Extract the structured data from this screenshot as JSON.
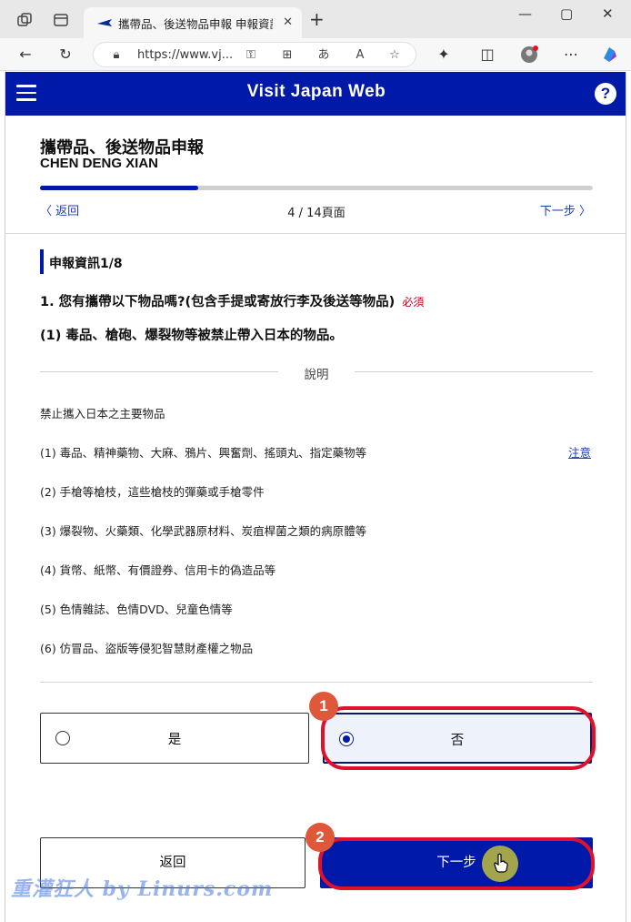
{
  "browser": {
    "tab_title": "攜帶品、後送物品申報 申報資訊",
    "tab_close": "✕",
    "new_tab": "+",
    "url": "https://www.vj...",
    "window_controls": [
      "—",
      "▢",
      "✕"
    ]
  },
  "header": {
    "site_title": "Visit Japan Web",
    "help_label": "?"
  },
  "form": {
    "title": "攜帶品、後送物品申報",
    "name": "CHEN DENG XIAN",
    "progress": {
      "current": 4,
      "total": 14
    },
    "back_link": "返回",
    "page_indicator": "4 / 14頁面",
    "next_link": "下一步"
  },
  "section": {
    "label": "申報資訊1/8",
    "question": "1. 您有攜帶以下物品嗎?(包含手提或寄放行李及後送等物品)",
    "required": "必須",
    "sub_question": "(1) 毒品、槍砲、爆裂物等被禁止帶入日本的物品。"
  },
  "explanation": {
    "heading": "說明",
    "intro": "禁止攜入日本之主要物品",
    "items": [
      "(1) 毒品、精神藥物、大麻、鴉片、興奮劑、搖頭丸、指定藥物等",
      "(2) 手槍等槍枝，這些槍枝的彈藥或手槍零件",
      "(3) 爆裂物、火藥類、化學武器原材料、炭疽桿菌之類的病原體等",
      "(4) 貨幣、紙幣、有價證券、信用卡的偽造品等",
      "(5) 色情雜誌、色情DVD、兒童色情等",
      "(6) 仿冒品、盜版等侵犯智慧財產權之物品"
    ],
    "note_link": "注意"
  },
  "options": {
    "yes": "是",
    "no": "否",
    "selected": "no"
  },
  "buttons": {
    "back": "返回",
    "next": "下一步"
  },
  "annotations": {
    "badge_1": "1",
    "badge_2": "2",
    "watermark": "重灌狂人 by Linurs.com",
    "ring_color": "#e0112b",
    "badge_color": "#e0583a"
  },
  "colors": {
    "brand": "#0019a9",
    "link": "#1a3fb8",
    "required": "#d0021b"
  }
}
